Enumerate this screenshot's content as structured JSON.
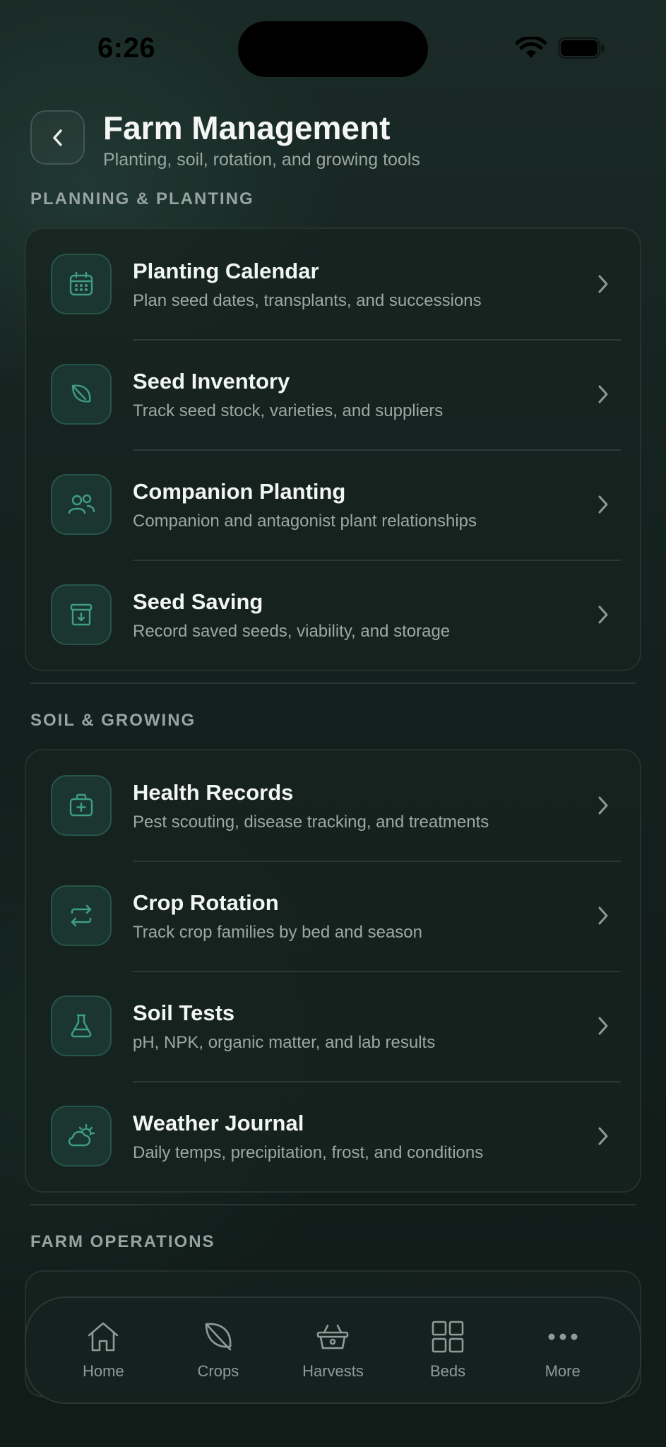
{
  "status_bar": {
    "time": "6:26"
  },
  "header": {
    "title": "Farm Management",
    "subtitle": "Planting, soil, rotation, and growing tools"
  },
  "sections": [
    {
      "label": "PLANNING & PLANTING",
      "items": [
        {
          "icon": "calendar-icon",
          "title": "Planting Calendar",
          "subtitle": "Plan seed dates, transplants, and successions"
        },
        {
          "icon": "leaf-icon",
          "title": "Seed Inventory",
          "subtitle": "Track seed stock, varieties, and suppliers"
        },
        {
          "icon": "users-icon",
          "title": "Companion Planting",
          "subtitle": "Companion and antagonist plant relationships"
        },
        {
          "icon": "archive-icon",
          "title": "Seed Saving",
          "subtitle": "Record saved seeds, viability, and storage"
        }
      ]
    },
    {
      "label": "SOIL & GROWING",
      "items": [
        {
          "icon": "medical-kit-icon",
          "title": "Health Records",
          "subtitle": "Pest scouting, disease tracking, and treatments"
        },
        {
          "icon": "rotate-arrows-icon",
          "title": "Crop Rotation",
          "subtitle": "Track crop families by bed and season"
        },
        {
          "icon": "flask-icon",
          "title": "Soil Tests",
          "subtitle": "pH, NPK, organic matter, and lab results"
        },
        {
          "icon": "cloud-sun-icon",
          "title": "Weather Journal",
          "subtitle": "Daily temps, precipitation, frost, and conditions"
        }
      ]
    },
    {
      "label": "FARM OPERATIONS",
      "items": []
    }
  ],
  "tab_bar": [
    {
      "icon": "home-icon",
      "label": "Home"
    },
    {
      "icon": "leaf-icon",
      "label": "Crops"
    },
    {
      "icon": "basket-icon",
      "label": "Harvests"
    },
    {
      "icon": "grid-icon",
      "label": "Beds"
    },
    {
      "icon": "more-icon",
      "label": "More"
    }
  ],
  "colors": {
    "background": "#13201d",
    "accent": "#3f9c88",
    "icon_box": "#1b3630"
  }
}
